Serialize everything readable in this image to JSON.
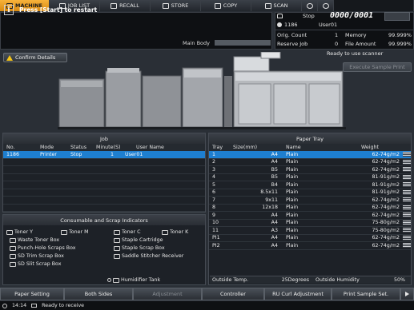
{
  "tabs": [
    {
      "label": "MACHINE",
      "icon": "machine-icon",
      "active": true
    },
    {
      "label": "JOB LIST",
      "icon": "job-list-icon"
    },
    {
      "label": "RECALL",
      "icon": "recall-icon"
    },
    {
      "label": "STORE",
      "icon": "store-icon"
    },
    {
      "label": "COPY",
      "icon": "copy-icon"
    },
    {
      "label": "SCAN",
      "icon": "scan-icon"
    },
    {
      "label": "",
      "icon": "globe-icon"
    },
    {
      "label": "",
      "icon": "power-icon"
    }
  ],
  "message": {
    "text": "Press [Start] to restart",
    "icon": "info-icon",
    "main_body_label": "Main Body"
  },
  "status": {
    "state": "Stop",
    "counter": "0000/0001",
    "job_no": "1186",
    "user": "User01",
    "orig_count_label": "Orig. Count",
    "orig_count": "1",
    "reserve_job_label": "Reserve Job",
    "reserve_job": "0",
    "memory_label": "Memory",
    "memory": "99.999%",
    "file_amount_label": "File Amount",
    "file_amount": "99.999%"
  },
  "machine": {
    "confirm_label": "Confirm Details",
    "ready_text": "Ready to use scanner",
    "exec_label": "Execute Sample Print"
  },
  "job": {
    "title": "Job",
    "columns": [
      "No.",
      "Mode",
      "Status",
      "Minute(S)",
      "User Name"
    ],
    "rows": [
      [
        "1186",
        "Printer",
        "Stop",
        "1",
        "User01"
      ]
    ]
  },
  "consumables": {
    "title": "Consumable and Scrap Indicators",
    "items": [
      {
        "label": "Toner Y"
      },
      {
        "label": "Toner M"
      },
      {
        "label": "Toner C"
      },
      {
        "label": "Toner K"
      },
      {
        "label": "Waste Toner Box"
      },
      {
        "label": "Staple Cartridge"
      },
      {
        "label": "Punch-Hole Scraps Box"
      },
      {
        "label": "Staple Scrap Box"
      },
      {
        "label": "SD Trim Scrap Box"
      },
      {
        "label": "Saddle Stitcher Receiver"
      },
      {
        "label": "SD Slit Scrap Box"
      },
      {
        "label": "Humidifier Tank"
      }
    ]
  },
  "paper_tray": {
    "title": "Paper Tray",
    "columns": [
      "Tray",
      "Size(mm)",
      "Name",
      "Weight"
    ],
    "rows": [
      [
        "1",
        "A4",
        "Plain",
        "62-74g/m2"
      ],
      [
        "2",
        "A4",
        "Plain",
        "62-74g/m2"
      ],
      [
        "3",
        "B5",
        "Plain",
        "62-74g/m2"
      ],
      [
        "4",
        "B5",
        "Plain",
        "81-91g/m2"
      ],
      [
        "5",
        "B4",
        "Plain",
        "81-91g/m2"
      ],
      [
        "6",
        "8.5x11",
        "Plain",
        "81-91g/m2"
      ],
      [
        "7",
        "9x11",
        "Plain",
        "62-74g/m2"
      ],
      [
        "8",
        "12x18",
        "Plain",
        "62-74g/m2"
      ],
      [
        "9",
        "A4",
        "Plain",
        "62-74g/m2"
      ],
      [
        "10",
        "A4",
        "Plain",
        "75-80g/m2"
      ],
      [
        "11",
        "A3",
        "Plain",
        "75-80g/m2"
      ],
      [
        "PI1",
        "A4",
        "Plain",
        "62-74g/m2"
      ],
      [
        "PI2",
        "A4",
        "Plain",
        "62-74g/m2"
      ]
    ],
    "outside_temp_label": "Outside Temp.",
    "outside_temp": "25Degrees",
    "outside_humidity_label": "Outside Humidity",
    "outside_humidity": "50%"
  },
  "bottom": {
    "buttons": [
      "Paper Setting",
      "Both Sides",
      "Adjustment",
      "Controller",
      "RU Curl Adjustment",
      "Print Sample Set."
    ]
  },
  "statusbar": {
    "time": "14:14",
    "text": "Ready to receive"
  }
}
